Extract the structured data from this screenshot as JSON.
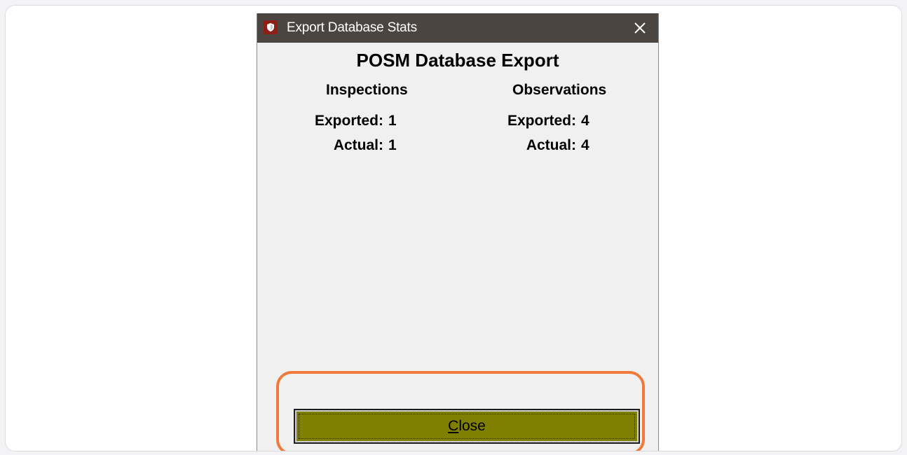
{
  "window": {
    "title": "Export Database Stats",
    "close_symbol": "✕"
  },
  "heading": "POSM Database Export",
  "inspections": {
    "header": "Inspections",
    "exported_label": "Exported:",
    "exported_value": "1",
    "actual_label": "Actual:",
    "actual_value": "1"
  },
  "observations": {
    "header": "Observations",
    "exported_label": "Exported:",
    "exported_value": "4",
    "actual_label": "Actual:",
    "actual_value": "4"
  },
  "close_button": {
    "mnemonic": "C",
    "rest": "lose"
  },
  "colors": {
    "titlebar": "#4a4541",
    "button_fill": "#7f7f00",
    "highlight": "#f07a3c"
  },
  "icons": {
    "app": "shield-icon",
    "close": "close-icon"
  }
}
